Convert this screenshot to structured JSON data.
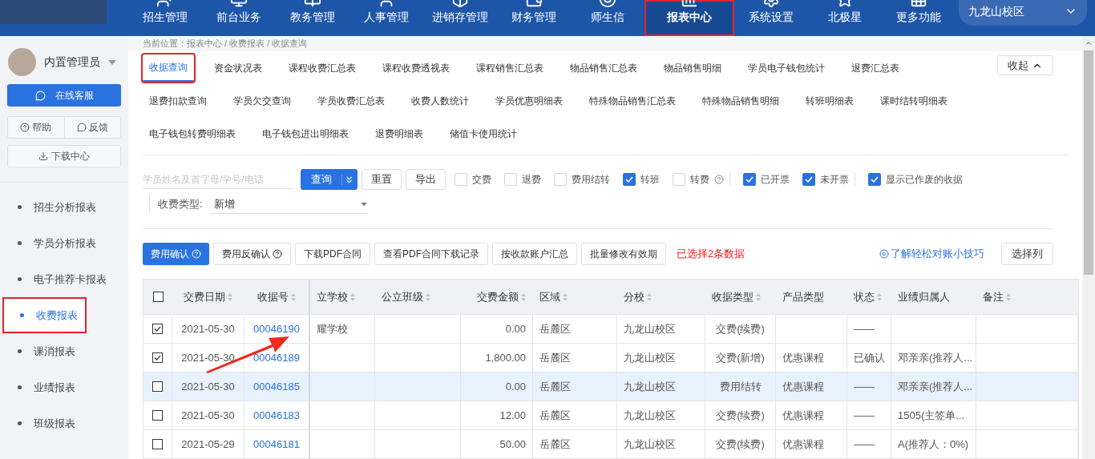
{
  "top_nav": {
    "items": [
      {
        "label": "招生管理",
        "selected": false,
        "highlighted": false
      },
      {
        "label": "前台业务",
        "selected": false,
        "highlighted": false
      },
      {
        "label": "教务管理",
        "selected": false,
        "highlighted": false
      },
      {
        "label": "人事管理",
        "selected": false,
        "highlighted": false
      },
      {
        "label": "进销存管理",
        "selected": false,
        "highlighted": false
      },
      {
        "label": "财务管理",
        "selected": false,
        "highlighted": false
      },
      {
        "label": "师生信",
        "selected": false,
        "highlighted": false
      },
      {
        "label": "报表中心",
        "selected": true,
        "highlighted": true
      },
      {
        "label": "系统设置",
        "selected": false,
        "highlighted": false
      },
      {
        "label": "北极星",
        "selected": false,
        "highlighted": false
      },
      {
        "label": "更多功能",
        "selected": false,
        "highlighted": false
      }
    ],
    "campus": "九龙山校区"
  },
  "sidebar": {
    "user": "内置管理员",
    "service_button": "在线客服",
    "help": "帮助",
    "feedback": "反馈",
    "download": "下载中心",
    "items": [
      {
        "label": "招生分析报表",
        "selected": false,
        "highlighted": false
      },
      {
        "label": "学员分析报表",
        "selected": false,
        "highlighted": false
      },
      {
        "label": "电子推荐卡报表",
        "selected": false,
        "highlighted": false
      },
      {
        "label": "收费报表",
        "selected": true,
        "highlighted": true
      },
      {
        "label": "课消报表",
        "selected": false,
        "highlighted": false
      },
      {
        "label": "业绩报表",
        "selected": false,
        "highlighted": false
      },
      {
        "label": "班级报表",
        "selected": false,
        "highlighted": false
      }
    ]
  },
  "breadcrumb": "当前位置：报表中心 / 收费报表 / 收据查询",
  "report_tabs": {
    "collapse": "收起",
    "rows": [
      [
        {
          "label": "收据查询",
          "selected": true,
          "highlighted": true
        },
        {
          "label": "资金状况表",
          "selected": false,
          "highlighted": false
        },
        {
          "label": "课程收费汇总表",
          "selected": false,
          "highlighted": false
        },
        {
          "label": "课程收费透视表",
          "selected": false,
          "highlighted": false
        },
        {
          "label": "课程销售汇总表",
          "selected": false,
          "highlighted": false
        },
        {
          "label": "物品销售汇总表",
          "selected": false,
          "highlighted": false
        },
        {
          "label": "物品销售明细",
          "selected": false,
          "highlighted": false
        },
        {
          "label": "学员电子钱包统计",
          "selected": false,
          "highlighted": false
        },
        {
          "label": "退费汇总表",
          "selected": false,
          "highlighted": false
        }
      ],
      [
        {
          "label": "退费扣款查询",
          "selected": false,
          "highlighted": false
        },
        {
          "label": "学员欠交查询",
          "selected": false,
          "highlighted": false
        },
        {
          "label": "学员收费汇总表",
          "selected": false,
          "highlighted": false
        },
        {
          "label": "收费人数统计",
          "selected": false,
          "highlighted": false
        },
        {
          "label": "学员优惠明细表",
          "selected": false,
          "highlighted": false
        },
        {
          "label": "特殊物品销售汇总表",
          "selected": false,
          "highlighted": false
        },
        {
          "label": "特殊物品销售明细",
          "selected": false,
          "highlighted": false
        },
        {
          "label": "转班明细表",
          "selected": false,
          "highlighted": false
        },
        {
          "label": "课时结转明细表",
          "selected": false,
          "highlighted": false
        }
      ],
      [
        {
          "label": "电子钱包转费明细表",
          "selected": false,
          "highlighted": false
        },
        {
          "label": "电子钱包进出明细表",
          "selected": false,
          "highlighted": false
        },
        {
          "label": "退费明细表",
          "selected": false,
          "highlighted": false
        },
        {
          "label": "储值卡使用统计",
          "selected": false,
          "highlighted": false
        }
      ]
    ]
  },
  "filters": {
    "search": {
      "placeholder": "学员姓名及首字母/学号/电话"
    },
    "query": "查询",
    "reset": "重置",
    "export": "导出",
    "checkbox_groups": [
      [
        {
          "label": "交费",
          "checked": false
        },
        {
          "label": "退费",
          "checked": false
        },
        {
          "label": "费用结转",
          "checked": false
        },
        {
          "label": "转班",
          "checked": true
        },
        {
          "label": "转费",
          "checked": false,
          "help": true
        }
      ],
      [
        {
          "label": "已开票",
          "checked": true
        },
        {
          "label": "未开票",
          "checked": true
        }
      ],
      [
        {
          "label": "显示已作废的收据",
          "checked": true
        }
      ]
    ],
    "fee_type": {
      "label": "收费类型:",
      "value": "新增"
    }
  },
  "actions": {
    "buttons": [
      {
        "label": "费用确认",
        "primary": true,
        "help": true
      },
      {
        "label": "费用反确认",
        "primary": false,
        "help": true
      },
      {
        "label": "下载PDF合同",
        "primary": false,
        "help": false
      },
      {
        "label": "查看PDF合同下载记录",
        "primary": false,
        "help": false
      },
      {
        "label": "按收款账户汇总",
        "primary": false,
        "help": false
      },
      {
        "label": "批量修改有效期",
        "primary": false,
        "help": false
      }
    ],
    "selection_note": "已选择2条数据",
    "tips_link": "了解轻松对账小技巧",
    "columns_button": "选择列"
  },
  "table": {
    "all_checked": false,
    "columns": [
      {
        "label": "交费日期",
        "sortable": true
      },
      {
        "label": "收据号",
        "sortable": true
      },
      {
        "label": "立学校",
        "sortable": true
      },
      {
        "label": "公立班级",
        "sortable": true
      },
      {
        "label": "交费金额",
        "sortable": true
      },
      {
        "label": "区域",
        "sortable": true
      },
      {
        "label": "分校",
        "sortable": true
      },
      {
        "label": "收据类型",
        "sortable": true
      },
      {
        "label": "产品类型",
        "sortable": false
      },
      {
        "label": "状态",
        "sortable": true
      },
      {
        "label": "业绩归属人",
        "sortable": false
      },
      {
        "label": "备注",
        "sortable": true
      }
    ],
    "rows": [
      {
        "checked": true,
        "highlighted": false,
        "date": "2021-05-30",
        "receipt": "00046190",
        "school": "耀学校",
        "amount": "0.00",
        "area": "岳麓区",
        "branch": "九龙山校区",
        "receipt_type": "交费(续费)",
        "status": "——"
      },
      {
        "checked": true,
        "highlighted": false,
        "date": "2021-05-30",
        "receipt": "00046189",
        "amount": "1,800.00",
        "area": "岳麓区",
        "branch": "九龙山校区",
        "receipt_type": "交费(新增)",
        "product_type": "优惠课程",
        "status": "已确认",
        "owner": "邓亲亲(推荐人..."
      },
      {
        "checked": false,
        "highlighted": true,
        "date": "2021-05-30",
        "receipt": "00046185",
        "amount": "0.00",
        "area": "岳麓区",
        "branch": "九龙山校区",
        "receipt_type": "费用结转",
        "product_type": "优惠课程",
        "status": "——",
        "owner": "邓亲亲(推荐人..."
      },
      {
        "checked": false,
        "highlighted": false,
        "date": "2021-05-30",
        "receipt": "00046183",
        "amount": "12.00",
        "area": "岳麓区",
        "branch": "九龙山校区",
        "receipt_type": "交费(续费)",
        "product_type": "优惠课程",
        "status": "——",
        "owner": "1505(主签单..."
      },
      {
        "checked": false,
        "highlighted": false,
        "date": "2021-05-29",
        "receipt": "00046181",
        "amount": "50.00",
        "area": "岳麓区",
        "branch": "九龙山校区",
        "receipt_type": "交费(续费)",
        "product_type": "优惠课程",
        "status": "——",
        "owner": "A(推荐人：0%)"
      }
    ]
  }
}
